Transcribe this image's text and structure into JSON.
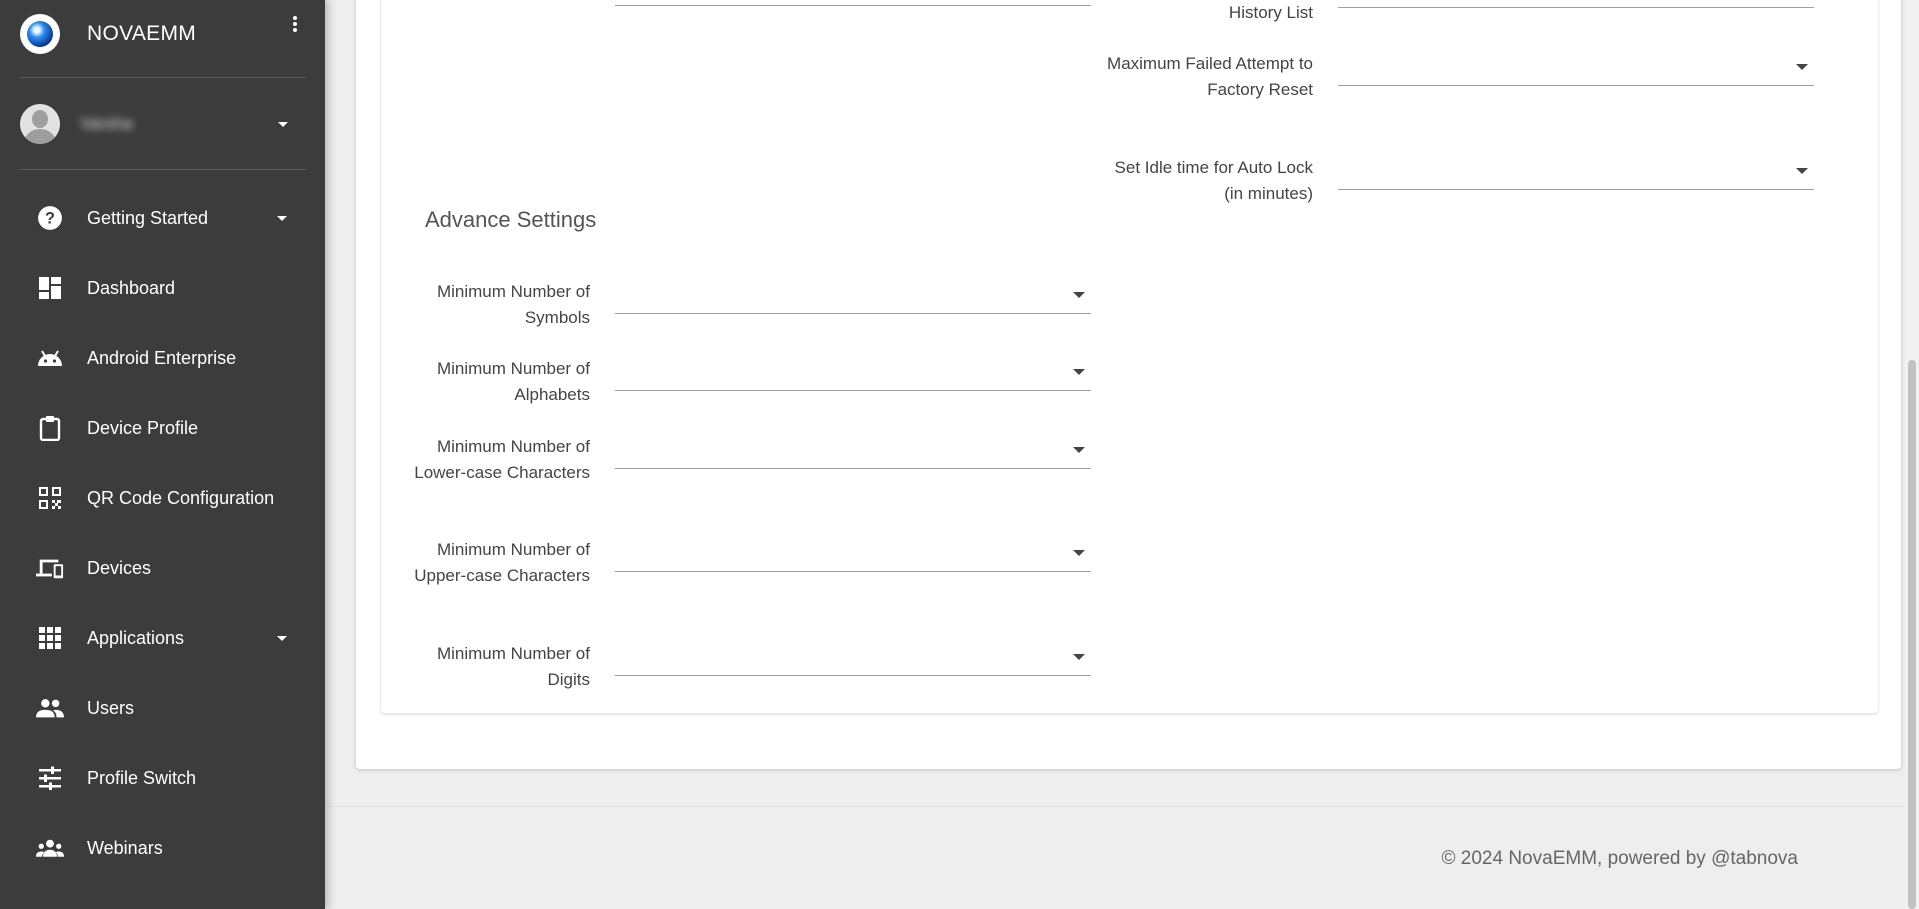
{
  "brand": {
    "name": "NOVAEMM"
  },
  "user": {
    "name": "Varsha"
  },
  "sidebar": {
    "items": [
      {
        "label": "Getting Started",
        "icon": "help-circle-icon",
        "has_caret": true
      },
      {
        "label": "Dashboard",
        "icon": "dashboard-icon"
      },
      {
        "label": "Android Enterprise",
        "icon": "android-icon"
      },
      {
        "label": "Device Profile",
        "icon": "clipboard-icon"
      },
      {
        "label": "QR Code Configuration",
        "icon": "qr-code-icon"
      },
      {
        "label": "Devices",
        "icon": "devices-icon"
      },
      {
        "label": "Applications",
        "icon": "apps-grid-icon",
        "has_caret": true
      },
      {
        "label": "Users",
        "icon": "users-icon"
      },
      {
        "label": "Profile Switch",
        "icon": "tune-icon"
      },
      {
        "label": "Webinars",
        "icon": "groups-icon"
      }
    ]
  },
  "right_fields": {
    "history_list": "History List",
    "max_failed": "Maximum Failed Attempt to Factory Reset",
    "idle_time": "Set Idle time for Auto Lock (in minutes)"
  },
  "advance": {
    "title": "Advance Settings",
    "fields": {
      "symbols": "Minimum Number of Symbols",
      "alphabets": "Minimum Number of Alphabets",
      "lowercase": "Minimum Number of Lower-case Characters",
      "uppercase": "Minimum Number of Upper-case Characters",
      "digits": "Minimum Number of Digits"
    }
  },
  "footer": {
    "text": "© 2024 NovaEMM, powered by @tabnova"
  }
}
